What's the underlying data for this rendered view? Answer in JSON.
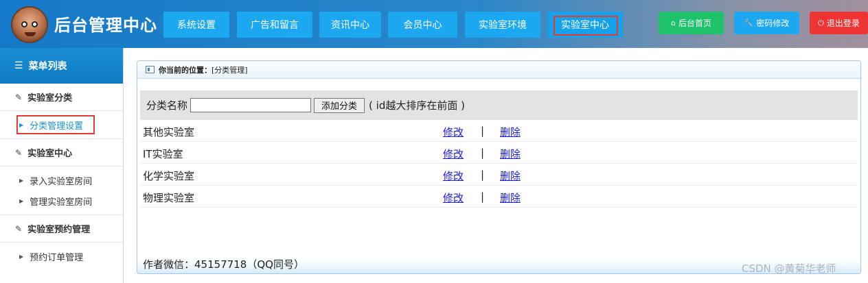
{
  "header": {
    "site_title": "后台管理中心",
    "nav": [
      {
        "label": "系统设置"
      },
      {
        "label": "广告和留言"
      },
      {
        "label": "资讯中心"
      },
      {
        "label": "会员中心"
      },
      {
        "label": "实验室环境"
      },
      {
        "label": "实验室中心"
      }
    ],
    "actions": {
      "home": {
        "label": "后台首页",
        "icon": "home-icon",
        "color": "#1ec26a"
      },
      "password": {
        "label": "密码修改",
        "icon": "wrench-icon",
        "color": "#1ca8f0"
      },
      "logout": {
        "label": "退出登录",
        "icon": "power-icon",
        "color": "#ef3434"
      }
    }
  },
  "sidebar": {
    "title": "菜单列表",
    "groups": [
      {
        "label": "实验室分类",
        "items": [
          {
            "label": "分类管理设置"
          }
        ]
      },
      {
        "label": "实验室中心",
        "items": [
          {
            "label": "录入实验室房间"
          },
          {
            "label": "管理实验室房间"
          }
        ]
      },
      {
        "label": "实验室预约管理",
        "items": [
          {
            "label": "预约订单管理"
          }
        ]
      }
    ]
  },
  "main": {
    "breadcrumb_prefix": "你当前的位置：",
    "breadcrumb_current": "[分类管理]",
    "add_form": {
      "label": "分类名称",
      "value": "",
      "button": "添加分类",
      "hint": "( id越大排序在前面 )"
    },
    "categories": [
      {
        "name": "其他实验室",
        "edit": "修改",
        "sep": "|",
        "delete": "删除"
      },
      {
        "name": "IT实验室",
        "edit": "修改",
        "sep": "|",
        "delete": "删除"
      },
      {
        "name": "化学实验室",
        "edit": "修改",
        "sep": "|",
        "delete": "删除"
      },
      {
        "name": "物理实验室",
        "edit": "修改",
        "sep": "|",
        "delete": "删除"
      }
    ],
    "footer": "作者微信：45157718（QQ同号）"
  },
  "watermark": "CSDN @黄菊华老师",
  "colors": {
    "nav_button": "#1ca8f0",
    "highlight_outline": "#e53935",
    "link": "#1a1ad6"
  }
}
